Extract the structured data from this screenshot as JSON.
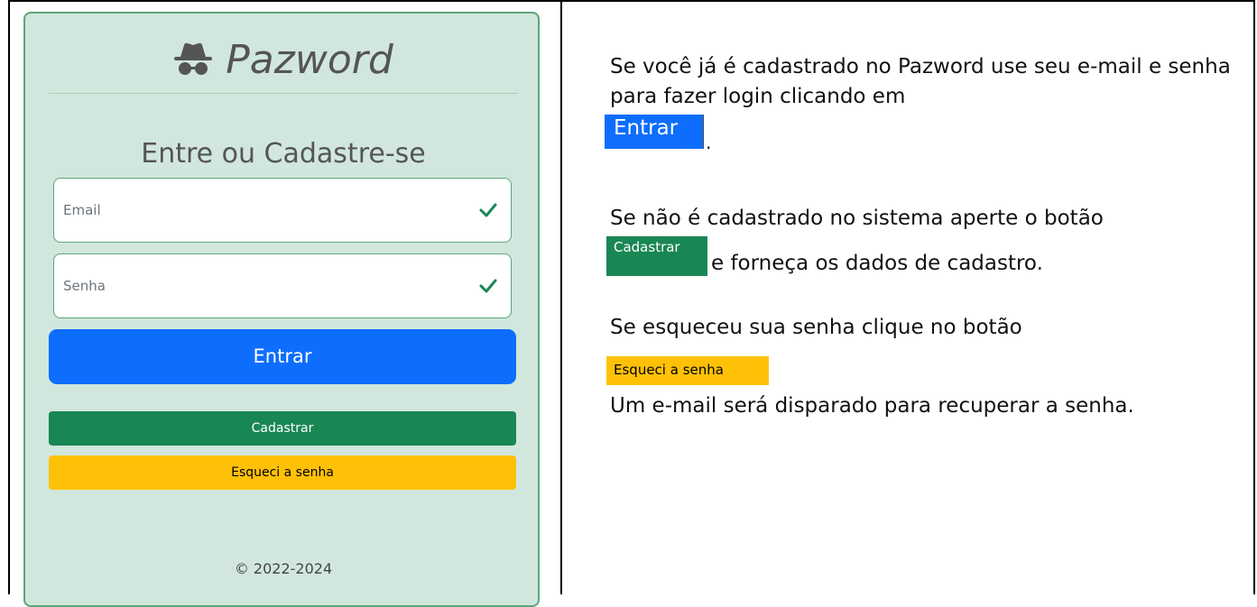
{
  "login": {
    "brand": "Pazword",
    "brand_icon": "incognito-icon",
    "subtitle": "Entre ou Cadastre-se",
    "email_placeholder": "Email",
    "password_placeholder": "Senha",
    "enter_label": "Entrar",
    "register_label": "Cadastrar",
    "forgot_label": "Esqueci a senha",
    "footer": "© 2022-2024"
  },
  "instructions": {
    "p1": "Se você já é cadastrado no Pazword use seu e-mail e senha para fazer login clicando em",
    "p1_button": "Entrar",
    "p1_end": ".",
    "p2": "Se não é cadastrado no sistema aperte o botão",
    "p2_button": "Cadastrar",
    "p2_end": "e forneça os dados de cadastro.",
    "p3": "Se esqueceu sua senha clique no botão",
    "p3_button": "Esqueci a senha",
    "p3_end": "Um e-mail será disparado para recuperar a senha."
  },
  "colors": {
    "card_bg": "#d1e7dd",
    "primary": "#0d6efd",
    "success": "#198754",
    "warning": "#ffc107"
  }
}
